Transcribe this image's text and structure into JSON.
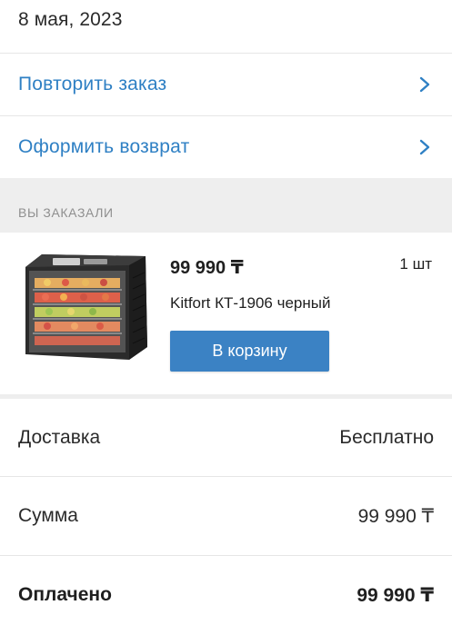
{
  "order": {
    "status_color": "#2e9d47",
    "date": "8 мая, 2023"
  },
  "actions": [
    {
      "label": "Повторить заказ",
      "icon": "chevron-right-icon"
    },
    {
      "label": "Оформить возврат",
      "icon": "chevron-right-icon"
    }
  ],
  "section": {
    "title": "ВЫ ЗАКАЗАЛИ"
  },
  "item": {
    "price": "99 990 ₸",
    "quantity": "1 шт",
    "name": "Kitfort КТ-1906 черный",
    "image": "food-dehydrator-image",
    "cart_button": "В корзину"
  },
  "summary": [
    {
      "label": "Доставка",
      "value": "Бесплатно"
    },
    {
      "label": "Сумма",
      "value": "99 990 ₸"
    },
    {
      "label": "Оплачено",
      "value": "99 990 ₸"
    }
  ],
  "colors": {
    "accent": "#2f80c4",
    "button": "#3b82c4",
    "section_bg": "#eeeeee"
  }
}
